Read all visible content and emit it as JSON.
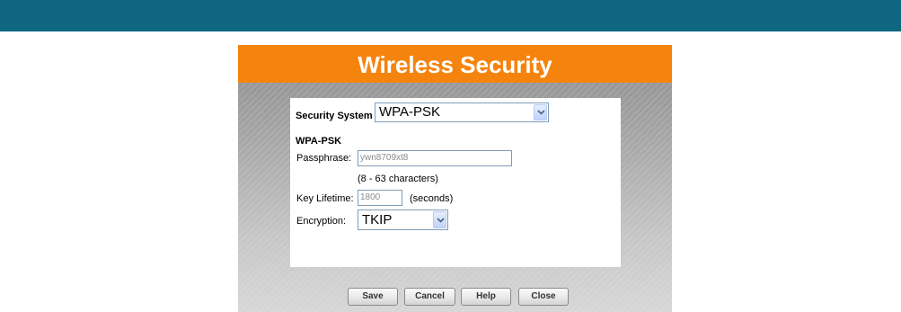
{
  "page": {
    "title": "Wireless Security"
  },
  "colors": {
    "top_bar": "#0e6680",
    "header": "#f5840e",
    "panel": "#b4b4b4"
  },
  "form": {
    "security_system": {
      "label": "Security System",
      "value": "WPA-PSK"
    },
    "section_title": "WPA-PSK",
    "passphrase": {
      "label": "Passphrase:",
      "value": "ywn8709xt8",
      "hint": "(8 - 63 characters)"
    },
    "key_lifetime": {
      "label": "Key Lifetime:",
      "value": "1800",
      "unit": "(seconds)"
    },
    "encryption": {
      "label": "Encryption:",
      "value": "TKIP"
    }
  },
  "buttons": {
    "save": "Save",
    "cancel": "Cancel",
    "help": "Help",
    "close": "Close"
  },
  "icons": {
    "dropdown": "chevron-down-icon"
  }
}
